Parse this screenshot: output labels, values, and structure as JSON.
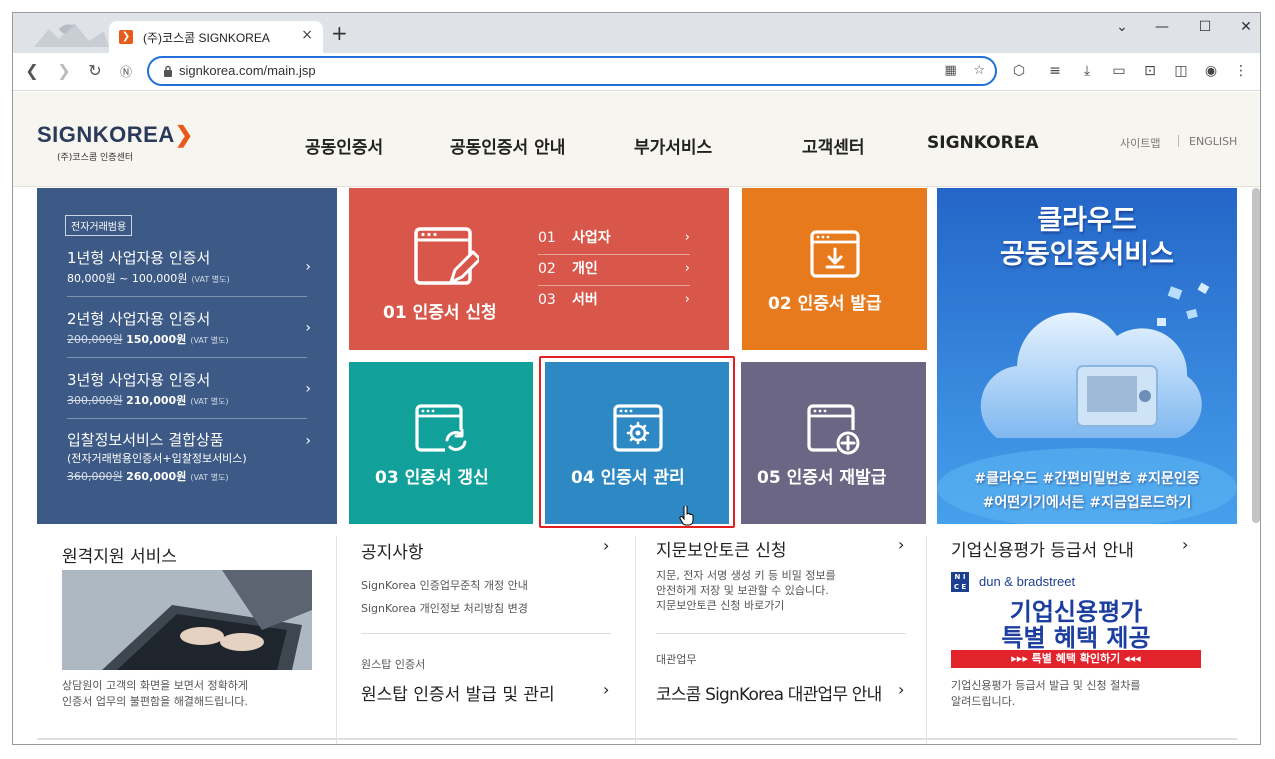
{
  "browser": {
    "tab_title": "(주)코스콤 SIGNKOREA",
    "tab_close": "×",
    "new_tab": "+",
    "url": "signkorea.com/main.jsp",
    "controls": {
      "minimize": "—",
      "maximize": "☐",
      "close": "✕",
      "tabsearch": "⌄"
    }
  },
  "header": {
    "logo_main": "SIGNKOREA",
    "logo_sub": "(주)코스콤 인증센터",
    "nav": [
      "공동인증서",
      "공동인증서 안내",
      "부가서비스",
      "고객센터",
      "SIGNKOREA"
    ],
    "util": [
      "사이트맵",
      "ENGLISH"
    ]
  },
  "price_panel": {
    "badge": "전자거래범용",
    "items": [
      {
        "title": "1년형 사업자용 인증서",
        "desc_plain": "80,000원 ~ 100,000원",
        "vat": "(VAT 별도)"
      },
      {
        "title": "2년형 사업자용 인증서",
        "old_price": "200,000원",
        "new_price": "150,000원",
        "vat": "(VAT 별도)"
      },
      {
        "title": "3년형 사업자용 인증서",
        "old_price": "300,000원",
        "new_price": "210,000원",
        "vat": "(VAT 별도)"
      },
      {
        "title": "입찰정보서비스 결합상품",
        "subtitle": "(전자거래범용인증서+입찰정보서비스)",
        "old_price": "360,000원",
        "new_price": "260,000원",
        "vat": "(VAT 별도)"
      }
    ]
  },
  "tiles": {
    "apply": {
      "label": "01 인증서 신청",
      "menu": [
        {
          "num": "01",
          "label": "사업자"
        },
        {
          "num": "02",
          "label": "개인"
        },
        {
          "num": "03",
          "label": "서버"
        }
      ]
    },
    "issue": {
      "label": "02 인증서 발급"
    },
    "renew": {
      "label": "03 인증서 갱신"
    },
    "manage": {
      "label": "04 인증서 관리"
    },
    "reissue": {
      "label": "05 인증서 재발급"
    }
  },
  "cloud_ad": {
    "title1": "클라우드",
    "title2": "공동인증서비스",
    "tags1": "#클라우드 #간편비밀번호 #지문인증",
    "tags2": "#어떤기기에서든 #지금업로드하기"
  },
  "bottom": {
    "remote": {
      "title": "원격지원 서비스",
      "desc1": "상담원이 고객의 화면을 보면서 정확하게",
      "desc2": "인증서 업무의 불편함을 해결해드립니다."
    },
    "notice": {
      "title": "공지사항",
      "items": [
        "SignKorea 인증업무준칙 개정 안내",
        "SignKorea 개인정보 처리방침 변경"
      ],
      "sub_label": "원스탑 인증서",
      "sub_title": "원스탑 인증서 발급 및 관리"
    },
    "token": {
      "title": "지문보안토큰 신청",
      "desc1": "지문, 전자 서명 생성 키 등 비밀 정보를",
      "desc2": "안전하게 저장 및 보관할 수 있습니다.",
      "desc3": "지문보안토큰 신청 바로가기",
      "sub_label": "대관업무",
      "sub_title": "코스콤 SignKorea 대관업무 안내"
    },
    "credit": {
      "title": "기업신용평가 등급서 안내",
      "brand": "dun & bradstreet",
      "ad_t1": "기업신용평가",
      "ad_t2": "특별 혜택 제공",
      "ad_bar": "▸▸▸  특별 혜택 확인하기  ◂◂◂",
      "desc1": "기업신용평가 등급서 발급 및 신청 절차를",
      "desc2": "알려드립니다."
    }
  },
  "colors": {
    "apply": "#d9574a",
    "issue": "#e67a1c",
    "renew": "#12a19a",
    "manage": "#2d88c4",
    "reissue": "#6a6684",
    "panel": "#3c5a85",
    "highlight": "#e3201f"
  }
}
